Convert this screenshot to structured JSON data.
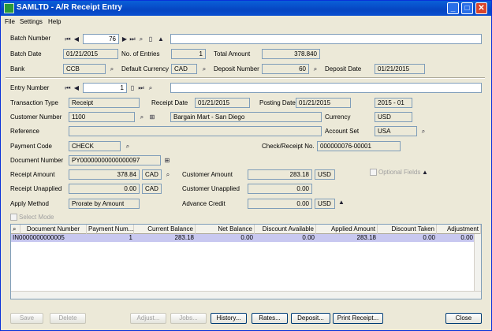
{
  "window": {
    "title": "SAMLTD - A/R Receipt Entry"
  },
  "menu": [
    "File",
    "Settings",
    "Help"
  ],
  "batch": {
    "number_label": "Batch Number",
    "number": "76",
    "date_label": "Batch Date",
    "date": "01/21/2015",
    "entries_label": "No. of Entries",
    "entries": "1",
    "total_label": "Total Amount",
    "total": "378.840",
    "bank_label": "Bank",
    "bank": "CCB",
    "currency_label": "Default Currency",
    "currency": "CAD",
    "deposit_label": "Deposit Number",
    "deposit": "60",
    "deposit_date_label": "Deposit Date",
    "deposit_date": "01/21/2015"
  },
  "entry": {
    "number_label": "Entry Number",
    "number": "1",
    "trans_type_label": "Transaction Type",
    "trans_type": "Receipt",
    "receipt_date_label": "Receipt Date",
    "receipt_date": "01/21/2015",
    "posting_date_label": "Posting Date",
    "posting_date": "01/21/2015",
    "period": "2015 - 01",
    "customer_label": "Customer Number",
    "customer": "1100",
    "customer_name": "Bargain Mart - San Diego",
    "currency_label": "Currency",
    "currency": "USD",
    "reference_label": "Reference",
    "account_set_label": "Account Set",
    "account_set": "USA",
    "payment_code_label": "Payment Code",
    "payment_code": "CHECK",
    "check_label": "Check/Receipt No.",
    "check": "000000076-00001",
    "document_label": "Document Number",
    "document": "PY00000000000000097",
    "receipt_amount_label": "Receipt Amount",
    "receipt_amount": "378.84",
    "receipt_currency": "CAD",
    "customer_amount_label": "Customer Amount",
    "customer_amount": "283.18",
    "customer_amount_currency": "USD",
    "optional_fields_label": "Optional Fields",
    "receipt_unapplied_label": "Receipt Unapplied",
    "receipt_unapplied": "0.00",
    "receipt_unapplied_currency": "CAD",
    "customer_unapplied_label": "Customer Unapplied",
    "customer_unapplied": "0.00",
    "apply_method_label": "Apply Method",
    "apply_method": "Prorate by Amount",
    "advance_credit_label": "Advance Credit",
    "advance_credit": "0.00",
    "advance_credit_currency": "USD",
    "select_mode_label": "Select Mode"
  },
  "grid": {
    "headers": [
      "Document Number",
      "Payment Num...",
      "Current Balance",
      "Net Balance",
      "Discount Available",
      "Applied Amount",
      "Discount Taken",
      "Adjustment"
    ],
    "rows": [
      [
        "IN0000000000005",
        "1",
        "283.18",
        "0.00",
        "0.00",
        "283.18",
        "0.00",
        "0.00"
      ]
    ]
  },
  "buttons": {
    "save": "Save",
    "delete": "Delete",
    "adjust": "Adjust...",
    "jobs": "Jobs...",
    "history": "History...",
    "rates": "Rates...",
    "deposit": "Deposit...",
    "print_receipt": "Print Receipt...",
    "close": "Close"
  },
  "icons": {
    "first": "first-icon",
    "prev": "prev-icon",
    "next": "next-icon",
    "last": "last-icon",
    "finder": "finder-icon",
    "new": "new-document-icon",
    "collapse": "collapse-icon",
    "zoom": "zoom-icon"
  }
}
